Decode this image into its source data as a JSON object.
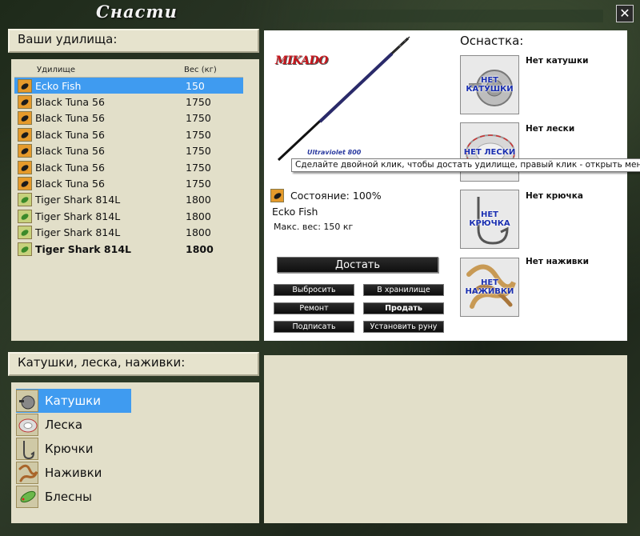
{
  "window": {
    "title": "Снасти",
    "close_glyph": "✕"
  },
  "rods_section": {
    "header": "Ваши удилища:",
    "columns": {
      "name": "Удилище",
      "weight": "Вес (кг)"
    },
    "rows": [
      {
        "name": "Ecko Fish",
        "weight": "150",
        "icon": "orange-rod-icon",
        "selected": true,
        "bold": false
      },
      {
        "name": "Black Tuna 56",
        "weight": "1750",
        "icon": "orange-rod-icon",
        "selected": false,
        "bold": false
      },
      {
        "name": "Black Tuna 56",
        "weight": "1750",
        "icon": "orange-rod-icon",
        "selected": false,
        "bold": false
      },
      {
        "name": "Black Tuna 56",
        "weight": "1750",
        "icon": "orange-rod-icon",
        "selected": false,
        "bold": false
      },
      {
        "name": "Black Tuna 56",
        "weight": "1750",
        "icon": "orange-rod-icon",
        "selected": false,
        "bold": false
      },
      {
        "name": "Black Tuna 56",
        "weight": "1750",
        "icon": "orange-rod-icon",
        "selected": false,
        "bold": false
      },
      {
        "name": "Black Tuna 56",
        "weight": "1750",
        "icon": "orange-rod-icon",
        "selected": false,
        "bold": false
      },
      {
        "name": "Tiger Shark 814L",
        "weight": "1800",
        "icon": "green-rod-icon",
        "selected": false,
        "bold": false
      },
      {
        "name": "Tiger Shark 814L",
        "weight": "1800",
        "icon": "green-rod-icon",
        "selected": false,
        "bold": false
      },
      {
        "name": "Tiger Shark 814L",
        "weight": "1800",
        "icon": "green-rod-icon",
        "selected": false,
        "bold": false
      },
      {
        "name": "Tiger Shark 814L",
        "weight": "1800",
        "icon": "green-rod-icon",
        "selected": false,
        "bold": true
      }
    ]
  },
  "details": {
    "brand_logo": "MIKADO",
    "rod_model_print": "Ultraviolet 800",
    "state": "Состояние: 100%",
    "rod_name": "Ecko Fish",
    "max_weight": "Макс. вес: 150 кг",
    "primary_button": "Достать",
    "buttons": {
      "throw_away": "Выбросить",
      "to_storage": "В хранилище",
      "repair": "Ремонт",
      "sell": "Продать",
      "sign": "Подписать",
      "install_rune": "Установить руну"
    },
    "equipment_title": "Оснастка:",
    "slots": [
      {
        "image_label": "НЕТ КАТУШКИ",
        "status": "Нет катушки"
      },
      {
        "image_label": "НЕТ ЛЕСКИ",
        "status": "Нет лески"
      },
      {
        "image_label": "НЕТ КРЮЧКА",
        "status": "Нет крючка"
      },
      {
        "image_label": "НЕТ НАЖИВКИ",
        "status": "Нет наживки"
      }
    ],
    "tooltip": "Сделайте двойной клик, чтобы достать удилище, правый клик - открыть меню"
  },
  "categories_section": {
    "header": "Катушки, леска, наживки:",
    "items": [
      {
        "label": "Катушки",
        "selected": true
      },
      {
        "label": "Леска",
        "selected": false
      },
      {
        "label": "Крючки",
        "selected": false
      },
      {
        "label": "Наживки",
        "selected": false
      },
      {
        "label": "Блесны",
        "selected": false
      }
    ]
  },
  "colors": {
    "selection": "#3f9bf0",
    "panel_beige": "#e2dfc9",
    "button_dark": "#111111",
    "slot_text_blue": "#1a2fb0",
    "logo_red": "#c8161c"
  }
}
